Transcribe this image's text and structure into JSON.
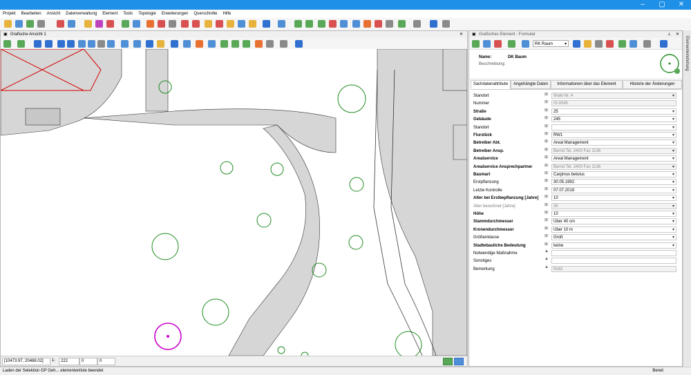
{
  "menu": [
    "Projekt",
    "Bearbeiten",
    "Ansicht",
    "Datenverwaltung",
    "Element",
    "Tools",
    "Topologie",
    "Erweiterungen",
    "Querschnitte",
    "Hilfe"
  ],
  "map": {
    "title": "Grafische Ansicht 1",
    "status": {
      "coords": "[10473.97, 20488.02]",
      "scale_prefix": "1:",
      "scale": "222",
      "value1": "0",
      "value2": "0"
    }
  },
  "form": {
    "title": "Grafisches Element - Formular",
    "room_select": "RK Raum",
    "name_label": "Name:",
    "name_value": "DK Baum",
    "desc_label": "Beschreibung:",
    "tabs": [
      "Sachdatenattribute",
      "Angehängte Daten",
      "Informationen über das Element",
      "Historie der Änderungen"
    ],
    "fields": [
      {
        "label": "Standort",
        "bold": false,
        "gray": false,
        "mark": "⊞",
        "value": "Wald-Nr. 4",
        "disabled": true,
        "dropdown": true
      },
      {
        "label": "Nummer",
        "bold": false,
        "gray": false,
        "mark": "⊞",
        "value": "IS-0045",
        "disabled": true,
        "dropdown": false
      },
      {
        "label": "Straße",
        "bold": true,
        "gray": false,
        "mark": "⊞",
        "value": "25",
        "disabled": false,
        "dropdown": true
      },
      {
        "label": "Gebäude",
        "bold": true,
        "gray": false,
        "mark": "⊞",
        "value": "245",
        "disabled": false,
        "dropdown": true
      },
      {
        "label": "Standort",
        "bold": false,
        "gray": false,
        "mark": "⊞",
        "value": "",
        "disabled": false,
        "dropdown": true
      },
      {
        "label": "Flurstück",
        "bold": true,
        "gray": false,
        "mark": "⊞",
        "value": "RW1",
        "disabled": false,
        "dropdown": true
      },
      {
        "label": "Betreiber Abt.",
        "bold": true,
        "gray": false,
        "mark": "⊞",
        "value": "Areal Management",
        "disabled": false,
        "dropdown": true
      },
      {
        "label": "Betreiber Ansp.",
        "bold": true,
        "gray": false,
        "mark": "⊞",
        "value": "Bernd Tel. 2400 Fax 1136",
        "disabled": true,
        "dropdown": true
      },
      {
        "label": "Arealservice",
        "bold": true,
        "gray": false,
        "mark": "⊞",
        "value": "Areal Management",
        "disabled": false,
        "dropdown": true
      },
      {
        "label": "Arealservice Ansprechpartner",
        "bold": true,
        "gray": false,
        "mark": "⊞",
        "value": "Bernd Tel. 2400 Fax 1136",
        "disabled": true,
        "dropdown": true
      },
      {
        "label": "Baumart",
        "bold": true,
        "gray": false,
        "mark": "⊞",
        "value": "Carpinus betulus",
        "disabled": false,
        "dropdown": true
      },
      {
        "label": "Erstpflanzung",
        "bold": false,
        "gray": false,
        "mark": "⊞",
        "value": "30.05.1992",
        "disabled": false,
        "dropdown": true
      },
      {
        "label": "Letzte Kontrolle",
        "bold": false,
        "gray": false,
        "mark": "⊞",
        "value": "07.07.2018",
        "disabled": false,
        "dropdown": true
      },
      {
        "label": "Alter bei Erstbepflanzung [Jahre]",
        "bold": true,
        "gray": false,
        "mark": "⊞",
        "value": "10",
        "disabled": false,
        "dropdown": true
      },
      {
        "label": "Alter berechnet [Jahre]",
        "bold": false,
        "gray": true,
        "mark": "⊞",
        "value": "35",
        "disabled": true,
        "dropdown": true
      },
      {
        "label": "Höhe",
        "bold": true,
        "gray": false,
        "mark": "⊞",
        "value": "10",
        "disabled": false,
        "dropdown": true
      },
      {
        "label": "Stammdurchmesser",
        "bold": true,
        "gray": false,
        "mark": "⊞",
        "value": "Über 40 cm",
        "disabled": false,
        "dropdown": true
      },
      {
        "label": "Kronendurchmesser",
        "bold": true,
        "gray": false,
        "mark": "⊞",
        "value": "Über 10 m",
        "disabled": false,
        "dropdown": true
      },
      {
        "label": "Größenklasse",
        "bold": false,
        "gray": false,
        "mark": "⊞",
        "value": "Groß",
        "disabled": false,
        "dropdown": true
      },
      {
        "label": "Stadtebauliche Bedeutung",
        "bold": true,
        "gray": false,
        "mark": "⊞",
        "value": "keine",
        "disabled": false,
        "dropdown": true
      },
      {
        "label": "Notwendige Maßnahme",
        "bold": false,
        "gray": false,
        "mark": "▲",
        "value": "",
        "disabled": false,
        "dropdown": false
      },
      {
        "label": "Sonstiges",
        "bold": false,
        "gray": false,
        "mark": "▲",
        "value": "",
        "disabled": false,
        "dropdown": false
      },
      {
        "label": "Bemerkung",
        "bold": false,
        "gray": false,
        "mark": "▲",
        "value": "Notiz",
        "disabled": true,
        "dropdown": false
      }
    ]
  },
  "sidebar_label": "Elementeinstellung",
  "statusbar": {
    "message": "Laden der Selektion GP Geh... elementenliste beendet",
    "right": "Bereit"
  },
  "colors": {
    "titlebar": "#1e90e8",
    "tree": "#1f8a1f",
    "tree_selected": "#cc00cc",
    "building": "#d6d6d6",
    "red": "#d40000"
  }
}
